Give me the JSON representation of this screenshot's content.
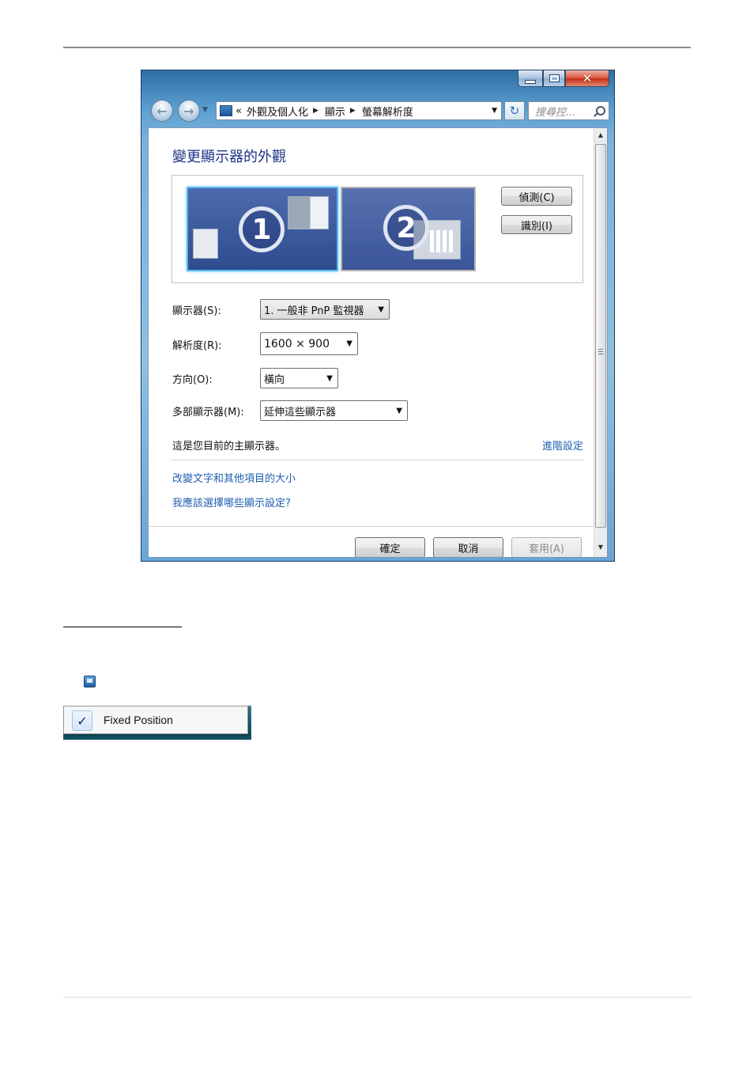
{
  "window": {
    "address": {
      "overflow": "«",
      "crumbs": [
        "外觀及個人化",
        "顯示",
        "螢幕解析度"
      ]
    },
    "search_placeholder": "搜尋控...",
    "heading": "變更顯示器的外觀",
    "monitors": [
      "1",
      "2"
    ],
    "detect_label": "偵測(C)",
    "identify_label": "識別(I)",
    "fields": {
      "display_label": "顯示器(S):",
      "display_value": "1. 一般非 PnP 監視器",
      "resolution_label": "解析度(R):",
      "resolution_value": "1600 × 900",
      "orientation_label": "方向(O):",
      "orientation_value": "橫向",
      "multi_label": "多部顯示器(M):",
      "multi_value": "延伸這些顯示器"
    },
    "status_text": "這是您目前的主顯示器。",
    "advanced_link": "進階設定",
    "links": [
      "改變文字和其他項目的大小",
      "我應該選擇哪些顯示設定?"
    ],
    "buttons": {
      "ok": "確定",
      "cancel": "取消",
      "apply": "套用(A)"
    }
  },
  "context_menu": {
    "item_label": "Fixed Position",
    "checked": true,
    "check_glyph": "✓"
  },
  "colors": {
    "link": "#1f5fb0",
    "heading": "#1e3287",
    "close_button": "#c22d13"
  },
  "icons": [
    "back-arrow-icon",
    "forward-arrow-icon",
    "computer-icon",
    "refresh-icon",
    "search-icon",
    "minimize-icon",
    "maximize-icon",
    "close-icon",
    "display-tray-icon",
    "checkmark-icon"
  ]
}
